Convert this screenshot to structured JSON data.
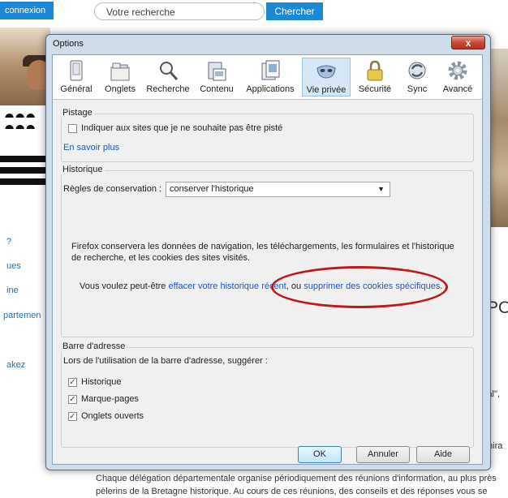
{
  "page": {
    "connexion": "connexion",
    "search_placeholder": "Votre recherche",
    "search_button": "Chercher",
    "side_links": [
      "?",
      "ues",
      "ine",
      "partemen",
      "akez"
    ],
    "heading_fragment": "PO",
    "right_text_1": "ial\",",
    "right_text_2": "mira",
    "bottom_line_1": "Chaque délégation départementale organise périodiquement des réunions d'information, au plus près",
    "bottom_line_2": "pèlerins de la Bretagne historique. Au cours de ces réunions, des conseils et des réponses vous se"
  },
  "dialog": {
    "title": "Options",
    "close_label": "x",
    "tabs": [
      {
        "label": "Général",
        "icon": "general-icon"
      },
      {
        "label": "Onglets",
        "icon": "tabs-icon"
      },
      {
        "label": "Recherche",
        "icon": "search-icon"
      },
      {
        "label": "Contenu",
        "icon": "content-icon"
      },
      {
        "label": "Applications",
        "icon": "applications-icon"
      },
      {
        "label": "Vie privée",
        "icon": "mask-icon",
        "active": true
      },
      {
        "label": "Sécurité",
        "icon": "lock-icon"
      },
      {
        "label": "Sync",
        "icon": "sync-icon"
      },
      {
        "label": "Avancé",
        "icon": "gear-icon"
      }
    ],
    "tracking": {
      "title": "Pistage",
      "do_not_track_label": "Indiquer aux sites que je ne souhaite pas être pisté",
      "do_not_track_checked": false,
      "learn_more": "En savoir plus"
    },
    "history": {
      "title": "Historique",
      "rules_label": "Règles de conservation :",
      "rules_value": "conserver l'historique",
      "description": "Firefox conservera les données de navigation, les téléchargements, les formulaires et l'historique",
      "description_2": "de recherche, et les cookies des sites visités.",
      "maybe_prefix": "Vous voulez peut-être ",
      "clear_history_link": "effacer votre historique récent",
      "or_text": ", ou ",
      "remove_cookies_link": "supprimer des cookies spécifiques",
      "period": "."
    },
    "address_bar": {
      "title": "Barre d'adresse",
      "suggest_label": "Lors de l'utilisation de la barre d'adresse, suggérer :",
      "options": [
        {
          "label": "Historique",
          "checked": true
        },
        {
          "label": "Marque-pages",
          "checked": true
        },
        {
          "label": "Onglets ouverts",
          "checked": true
        }
      ]
    },
    "buttons": {
      "ok": "OK",
      "cancel": "Annuler",
      "help": "Aide"
    },
    "colors": {
      "accent_link": "#1e56c2",
      "highlight_ellipse": "#c0191d",
      "active_tab_bg": "#d6e8f8"
    }
  }
}
